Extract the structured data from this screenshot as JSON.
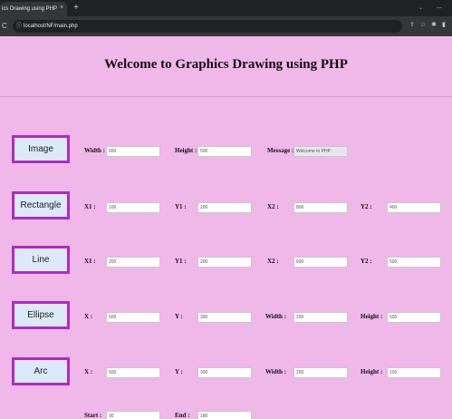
{
  "browser": {
    "tab_title": "ics Drawing using PHP",
    "tab_close": "×",
    "new_tab": "+",
    "reload": "C",
    "url": "localhost/NF/main.php",
    "win_min": "⌄",
    "win_ctrl": "—"
  },
  "page": {
    "title": "Welcome to Graphics Drawing using PHP"
  },
  "image": {
    "button": "Image",
    "width_label": "Width :",
    "width_value": "600",
    "height_label": "Height :",
    "height_value": "500",
    "message_label": "Message :",
    "message_value": "Welcome to PHP"
  },
  "rectangle": {
    "button": "Rectangle",
    "x1_label": "X1 :",
    "x1_value": "100",
    "y1_label": "Y1 :",
    "y1_value": "200",
    "x2_label": "X2 :",
    "x2_value": "800",
    "y2_label": "Y2 :",
    "y2_value": "400"
  },
  "line": {
    "button": "Line",
    "x1_label": "X1 :",
    "x1_value": "200",
    "y1_label": "Y1 :",
    "y1_value": "200",
    "x2_label": "X2 :",
    "x2_value": "600",
    "y2_label": "Y2 :",
    "y2_value": "500"
  },
  "ellipse": {
    "button": "Ellipse",
    "x_label": "X :",
    "x_value": "500",
    "y_label": "Y :",
    "y_value": "300",
    "width_label": "Width :",
    "width_value": "200",
    "height_label": "Height :",
    "height_value": "500"
  },
  "arc": {
    "button": "Arc",
    "x_label": "X :",
    "x_value": "500",
    "y_label": "Y :",
    "y_value": "300",
    "width_label": "Width :",
    "width_value": "200",
    "height_label": "Height :",
    "height_value": "100",
    "start_label": "Start :",
    "start_value": "90",
    "end_label": "End :",
    "end_value": "180"
  }
}
